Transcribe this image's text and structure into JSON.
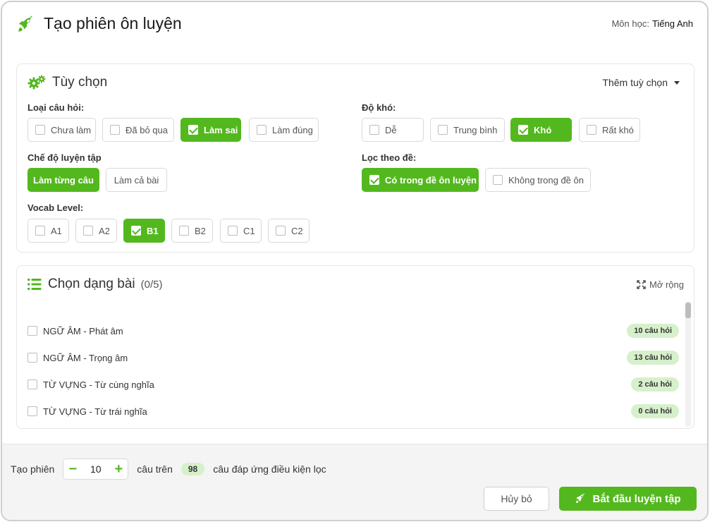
{
  "header": {
    "title": "Tạo phiên ôn luyện",
    "subject_label": "Môn học:",
    "subject_value": "Tiếng Anh"
  },
  "options": {
    "title": "Tùy chọn",
    "more_options": "Thêm tuỳ chọn",
    "question_type": {
      "label": "Loại câu hỏi:",
      "items": [
        {
          "label": "Chưa làm",
          "checked": false
        },
        {
          "label": "Đã bỏ qua",
          "checked": false
        },
        {
          "label": "Làm sai",
          "checked": true
        },
        {
          "label": "Làm đúng",
          "checked": false
        }
      ]
    },
    "difficulty": {
      "label": "Độ khó:",
      "items": [
        {
          "label": "Dễ",
          "checked": false
        },
        {
          "label": "Trung bình",
          "checked": false
        },
        {
          "label": "Khó",
          "checked": true
        },
        {
          "label": "Rất khó",
          "checked": false
        }
      ]
    },
    "practice_mode": {
      "label": "Chế độ luyện tập",
      "items": [
        {
          "label": "Làm từng câu",
          "selected": true
        },
        {
          "label": "Làm cả bài",
          "selected": false
        }
      ]
    },
    "exam_filter": {
      "label": "Lọc theo đề:",
      "items": [
        {
          "label": "Có trong đề ôn luyện",
          "checked": true
        },
        {
          "label": "Không trong đề ôn",
          "checked": false
        }
      ]
    },
    "vocab_level": {
      "label": "Vocab Level:",
      "items": [
        {
          "label": "A1",
          "checked": false
        },
        {
          "label": "A2",
          "checked": false
        },
        {
          "label": "B1",
          "checked": true
        },
        {
          "label": "B2",
          "checked": false
        },
        {
          "label": "C1",
          "checked": false
        },
        {
          "label": "C2",
          "checked": false
        }
      ]
    }
  },
  "exercise_types": {
    "title": "Chọn dạng bài",
    "count": "(0/5)",
    "expand_label": "Mở rộng",
    "items": [
      {
        "label": "NGỮ ÂM - Phát âm",
        "badge": "10 câu hỏi"
      },
      {
        "label": "NGỮ ÂM - Trọng âm",
        "badge": "13 câu hỏi"
      },
      {
        "label": "TỪ VỰNG - Từ cùng nghĩa",
        "badge": "2 câu hỏi"
      },
      {
        "label": "TỪ VỰNG - Từ trái nghĩa",
        "badge": "0 câu hỏi"
      }
    ]
  },
  "footer": {
    "create_label": "Tạo phiên",
    "question_count": "10",
    "on_label": "câu trên",
    "matching_count": "98",
    "matching_label": "câu đáp ứng điều kiện lọc",
    "cancel": "Hủy bỏ",
    "start": "Bắt đầu luyện tập"
  },
  "colors": {
    "accent": "#53b81e",
    "badge_bg": "#d6f0cb"
  }
}
